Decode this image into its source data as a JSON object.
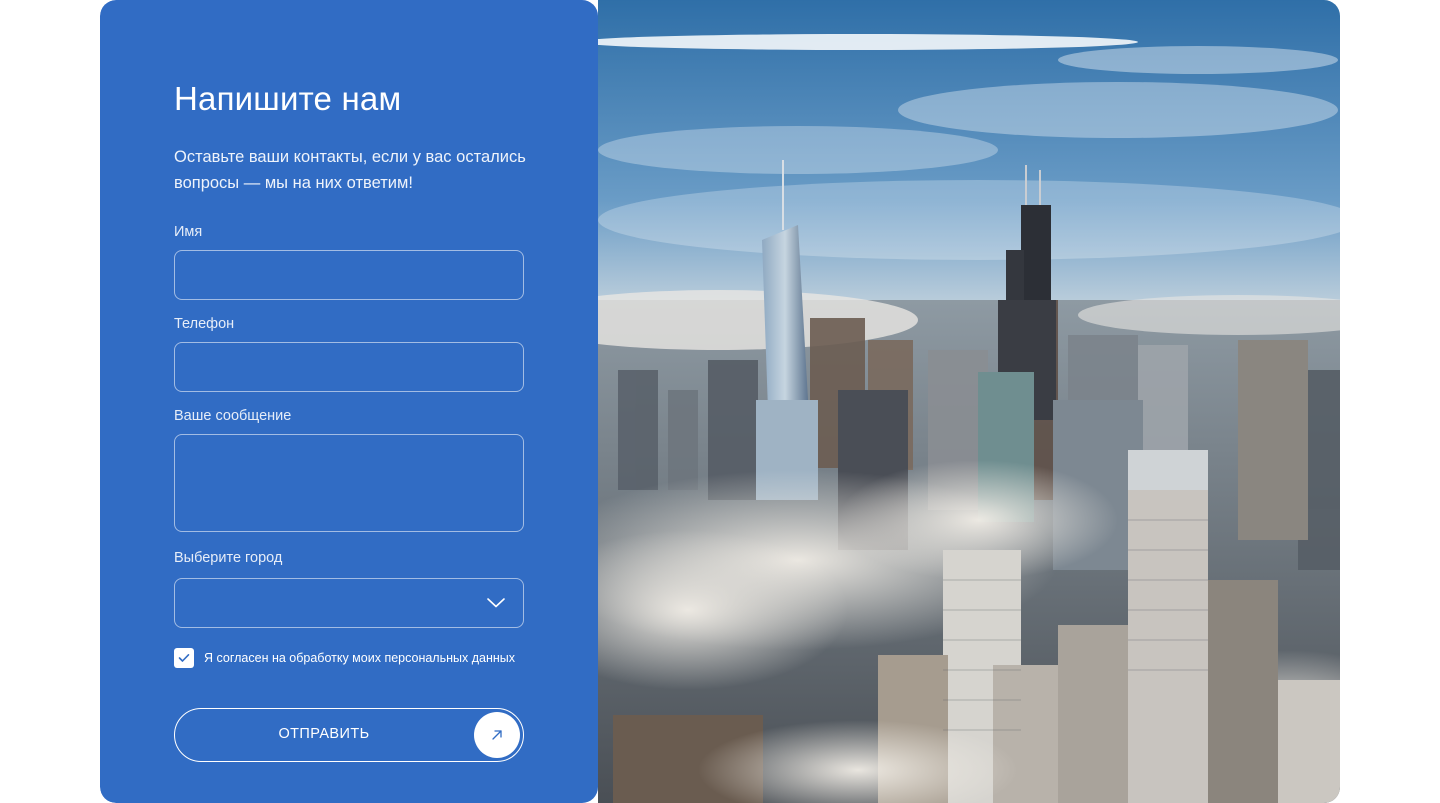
{
  "form": {
    "title": "Напишите нам",
    "subtitle": "Оставьте ваши контакты, если у вас остались вопросы — мы на них ответим!",
    "name_label": "Имя",
    "name_value": "",
    "phone_label": "Телефон",
    "phone_value": "",
    "message_label": "Ваше сообщение",
    "message_value": "",
    "city_label": "Выберите город",
    "city_value": "",
    "consent_checked": true,
    "consent_text": "Я согласен на обработку моих персональных данных",
    "submit_label": "ОТПРАВИТЬ"
  },
  "icons": {
    "select": "chevron-down-icon",
    "checkbox": "check-icon",
    "submit": "arrow-up-right-icon"
  },
  "colors": {
    "panel_background": "#316cc4",
    "text": "#ffffff",
    "accent_icon": "#316cc4"
  },
  "image": {
    "subject": "city-skyline-photo"
  }
}
